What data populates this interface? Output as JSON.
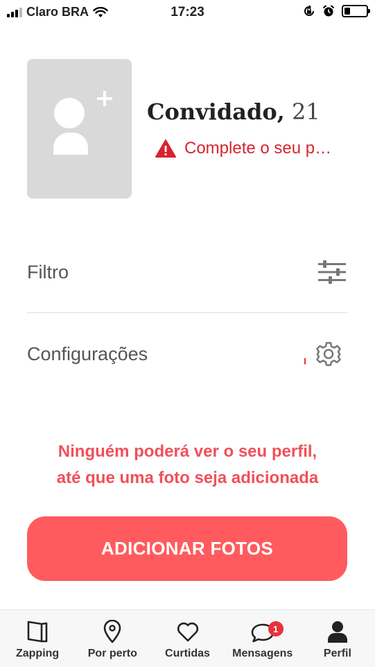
{
  "status_bar": {
    "carrier": "Claro BRA",
    "time": "17:23",
    "icons": [
      "signal-icon",
      "wifi-icon",
      "rotation-lock-icon",
      "alarm-icon",
      "battery-icon"
    ]
  },
  "profile": {
    "name": "Convidado",
    "separator": ",",
    "age": "21",
    "warning": "Complete o seu p…",
    "avatar_icon": "add-user-icon"
  },
  "menu": {
    "filter_label": "Filtro",
    "settings_label": "Configurações"
  },
  "notice": {
    "line1": "Ninguém poderá ver o seu perfil,",
    "line2": "até que uma foto seja adicionada"
  },
  "primary_button": {
    "label": "ADICIONAR FOTOS"
  },
  "tabs": [
    {
      "label": "Zapping",
      "icon": "cards-icon"
    },
    {
      "label": "Por perto",
      "icon": "location-pin-icon"
    },
    {
      "label": "Curtidas",
      "icon": "heart-icon"
    },
    {
      "label": "Mensagens",
      "icon": "chat-bubble-icon",
      "badge": "1"
    },
    {
      "label": "Perfil",
      "icon": "user-icon"
    }
  ],
  "colors": {
    "accent": "#ff5b5e",
    "warning": "#d8232f",
    "notice": "#f0505a",
    "avatar_bg": "#d9d9d9"
  }
}
